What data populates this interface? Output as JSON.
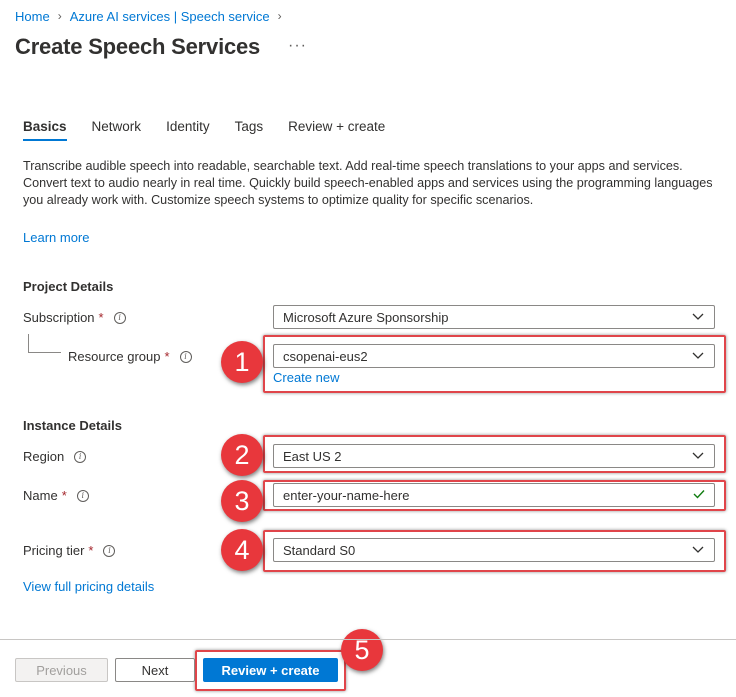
{
  "breadcrumb": {
    "items": [
      "Home",
      "Azure AI services | Speech service"
    ]
  },
  "page": {
    "title": "Create Speech Services",
    "more": "···"
  },
  "tabs": [
    {
      "label": "Basics",
      "active": true
    },
    {
      "label": "Network",
      "active": false
    },
    {
      "label": "Identity",
      "active": false
    },
    {
      "label": "Tags",
      "active": false
    },
    {
      "label": "Review + create",
      "active": false
    }
  ],
  "description": "Transcribe audible speech into readable, searchable text. Add real-time speech translations to your apps and services. Convert text to audio nearly in real time. Quickly build speech-enabled apps and services using the programming languages you already work with. Customize speech systems to optimize quality for specific scenarios.",
  "learn_more": "Learn more",
  "project_details": {
    "title": "Project Details",
    "subscription": {
      "label": "Subscription",
      "required": "*",
      "value": "Microsoft Azure Sponsorship"
    },
    "resource_group": {
      "label": "Resource group",
      "required": "*",
      "value": "csopenai-eus2",
      "create_new": "Create new"
    }
  },
  "instance_details": {
    "title": "Instance Details",
    "region": {
      "label": "Region",
      "value": "East US 2"
    },
    "name": {
      "label": "Name",
      "required": "*",
      "value": "enter-your-name-here"
    },
    "pricing_tier": {
      "label": "Pricing tier",
      "required": "*",
      "value": "Standard S0"
    },
    "pricing_link": "View full pricing details"
  },
  "callouts": [
    "1",
    "2",
    "3",
    "4",
    "5"
  ],
  "footer": {
    "previous": "Previous",
    "next": "Next",
    "review_create": "Review + create"
  },
  "colors": {
    "accent": "#0078d4",
    "callout": "#e8373c",
    "highlight": "#e0454a",
    "valid_check": "#107c10",
    "required": "#a4262c"
  },
  "icons": {
    "info": "info-icon",
    "dropdown": "chevron-down-icon",
    "valid": "checkmark-icon",
    "breadcrumb_sep": "chevron-right-icon"
  }
}
